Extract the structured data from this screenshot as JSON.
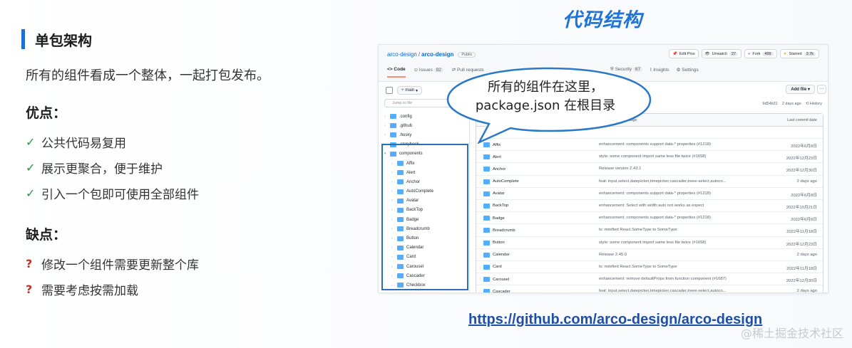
{
  "left": {
    "section_title": "单包架构",
    "intro": "所有的组件看成一个整体，一起打包发布。",
    "pros_title": "优点：",
    "pros": [
      "公共代码易复用",
      "展示更聚合，便于维护",
      "引入一个包即可使用全部组件"
    ],
    "pros_mark": "✓",
    "cons_title": "缺点：",
    "cons": [
      "修改一个组件需要更新整个库",
      "需要考虑按需加载"
    ],
    "cons_mark": "?"
  },
  "heading": "代码结构",
  "github": {
    "owner": "arco-design",
    "slash": "/",
    "repo": "arco-design",
    "visibility": "Public",
    "edit_pins": "Edit Pins",
    "unwatch": "Unwatch",
    "unwatch_count": "27",
    "fork": "Fork",
    "fork_count": "499",
    "starred": "Starred",
    "starred_count": "3.7k",
    "tabs": [
      "Code",
      "Issues",
      "Pull requests"
    ],
    "issues_count": "92",
    "tabs_right": [
      "Security",
      "Insights",
      "Settings"
    ],
    "security_count": "67",
    "branch": "main",
    "jump_placeholder": "Jump to file",
    "add_file": "Add file",
    "more": "···",
    "commit_hash": "9d54b31",
    "commit_time": "2 days ago",
    "history": "History",
    "col_message": "Last commit message",
    "col_date": "Last commit date",
    "tree": [
      {
        "name": ".config",
        "sub": false
      },
      {
        "name": ".github",
        "sub": false
      },
      {
        "name": ".husky",
        "sub": false
      },
      {
        "name": ".storybook",
        "sub": false
      },
      {
        "name": "components",
        "sub": false
      },
      {
        "name": "Affix",
        "sub": true
      },
      {
        "name": "Alert",
        "sub": true
      },
      {
        "name": "Anchor",
        "sub": true
      },
      {
        "name": "AutoComplete",
        "sub": true
      },
      {
        "name": "Avatar",
        "sub": true
      },
      {
        "name": "BackTop",
        "sub": true
      },
      {
        "name": "Badge",
        "sub": true
      },
      {
        "name": "Breadcrumb",
        "sub": true
      },
      {
        "name": "Button",
        "sub": true
      },
      {
        "name": "Calendar",
        "sub": true
      },
      {
        "name": "Card",
        "sub": true
      },
      {
        "name": "Carousel",
        "sub": true
      },
      {
        "name": "Cascader",
        "sub": true
      },
      {
        "name": "Checkbox",
        "sub": true
      }
    ],
    "rows": [
      {
        "name": "Affix",
        "msg": "enhancement: components support data-* properties (#1218)",
        "date": "2022年6月8日"
      },
      {
        "name": "Alert",
        "msg": "style: some component import same less file twice (#1658)",
        "date": "2022年12月23日"
      },
      {
        "name": "Anchor",
        "msg": "Release version 2.43.1",
        "date": "2022年12月30日"
      },
      {
        "name": "AutoComplete",
        "msg": "feat: input,select,datepicker,timepicker,cascader,treee-select,autoco...",
        "date": "2 days ago"
      },
      {
        "name": "Avatar",
        "msg": "enhancement: components support data-* properties (#1218)",
        "date": "2022年6月8日"
      },
      {
        "name": "BackTop",
        "msg": "enhancement: Select with width:auto not works as expect",
        "date": "2022年10月21日"
      },
      {
        "name": "Badge",
        "msg": "enhancement: components support data-* properties (#1218)",
        "date": "2022年6月8日"
      },
      {
        "name": "Breadcrumb",
        "msg": "ts: minified React.SomeType to SomeType",
        "date": "2022年11月18日"
      },
      {
        "name": "Button",
        "msg": "style: some component import same less file twice (#1658)",
        "date": "2022年12月23日"
      },
      {
        "name": "Calendar",
        "msg": "Release 2.45.0",
        "date": "2 days ago"
      },
      {
        "name": "Card",
        "msg": "ts: minified React.SomeType to SomeType",
        "date": "2022年11月18日"
      },
      {
        "name": "Carousel",
        "msg": "enhancement: remove defaultProps from function component (#1687)",
        "date": "2022年12月30日"
      },
      {
        "name": "Cascader",
        "msg": "feat: input,select,datepicker,timepicker,cascader,treee-select,autoco...",
        "date": "2 days ago"
      }
    ]
  },
  "bubble": {
    "line1": "所有的组件在这里，",
    "line2": "package.json 在根目录"
  },
  "link": "https://github.com/arco-design/arco-design",
  "watermark": "@稀土掘金技术社区",
  "colors": {
    "accent": "#1f6fd1",
    "check": "#1e9c3a",
    "question": "#d52a1d",
    "highlight_border": "#2a6fb8"
  }
}
